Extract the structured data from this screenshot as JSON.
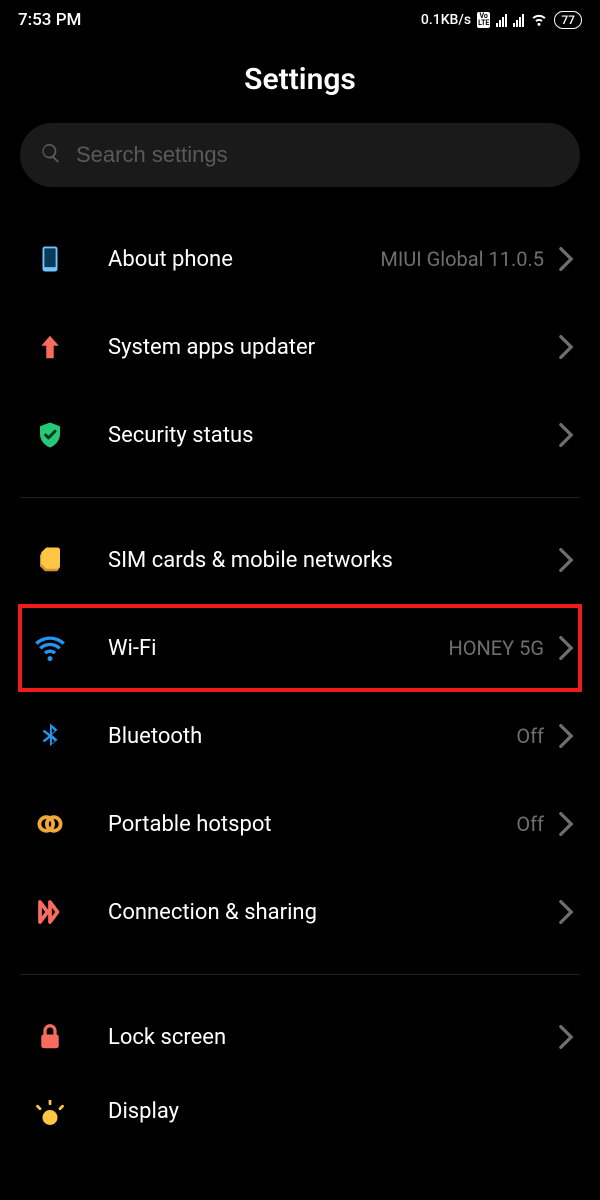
{
  "status": {
    "time": "7:53 PM",
    "net_speed": "0.1KB/s",
    "battery": "77"
  },
  "title": "Settings",
  "search_placeholder": "Search settings",
  "items": {
    "about_phone": {
      "label": "About phone",
      "value": "MIUI Global 11.0.5"
    },
    "system_updater": {
      "label": "System apps updater",
      "value": ""
    },
    "security_status": {
      "label": "Security status",
      "value": ""
    },
    "sim": {
      "label": "SIM cards & mobile networks",
      "value": ""
    },
    "wifi": {
      "label": "Wi-Fi",
      "value": "HONEY 5G"
    },
    "bluetooth": {
      "label": "Bluetooth",
      "value": "Off"
    },
    "hotspot": {
      "label": "Portable hotspot",
      "value": "Off"
    },
    "connection": {
      "label": "Connection & sharing",
      "value": ""
    },
    "lockscreen": {
      "label": "Lock screen",
      "value": ""
    },
    "display": {
      "label": "Display",
      "value": ""
    }
  },
  "colors": {
    "accent_blue": "#2196f3",
    "accent_green": "#27c977",
    "accent_orange": "#f2a73b",
    "accent_red": "#f76c5e",
    "highlight": "#ef1c1c"
  }
}
